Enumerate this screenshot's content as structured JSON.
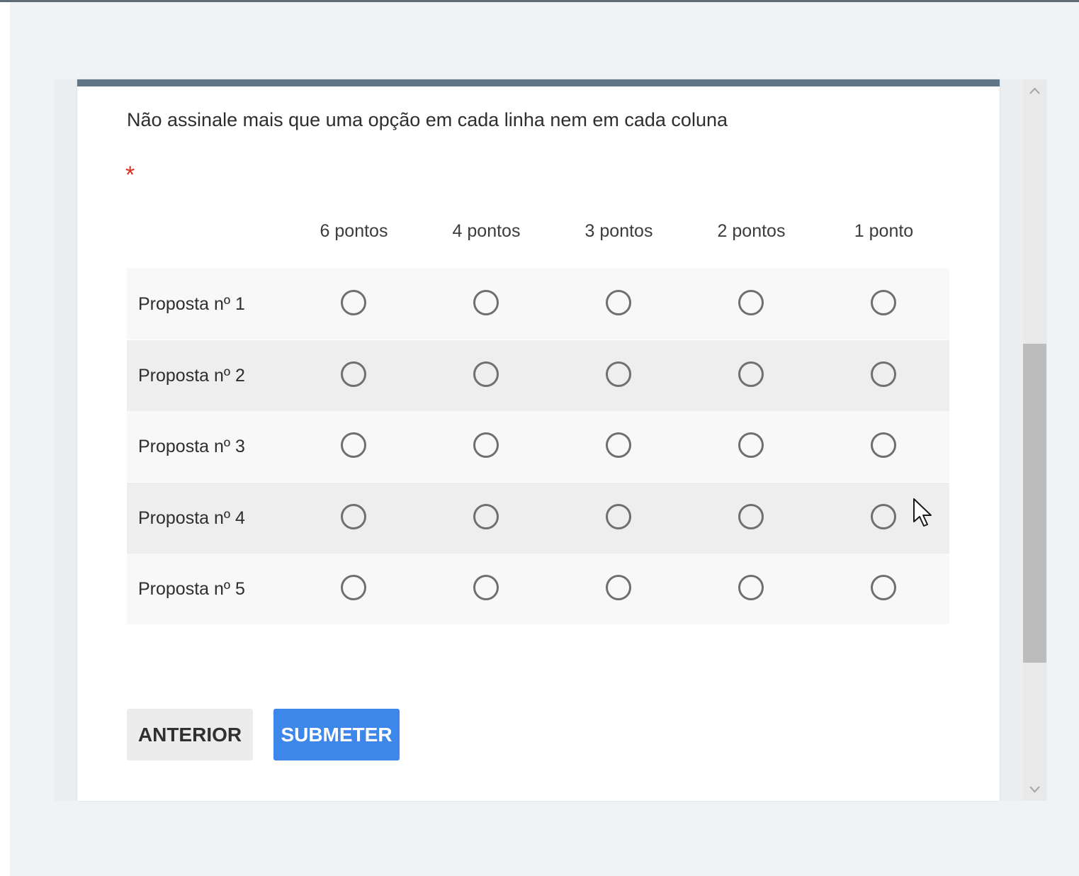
{
  "question": {
    "text": "Não assinale mais que uma opção em cada linha nem em cada coluna",
    "required_marker": "*"
  },
  "grid": {
    "columns": [
      "6 pontos",
      "4 pontos",
      "3 pontos",
      "2 pontos",
      "1 ponto"
    ],
    "rows": [
      "Proposta nº 1",
      "Proposta nº 2",
      "Proposta nº 3",
      "Proposta nº 4",
      "Proposta nº 5"
    ]
  },
  "buttons": {
    "previous_label": "ANTERIOR",
    "submit_label": "SUBMETER"
  },
  "colors": {
    "accent_bar": "#5f7786",
    "submit": "#3d86ea",
    "required": "#d93025"
  },
  "icons": {
    "scroll_up": "chevron-up-icon",
    "scroll_down": "chevron-down-icon",
    "cursor": "mouse-pointer-icon"
  }
}
